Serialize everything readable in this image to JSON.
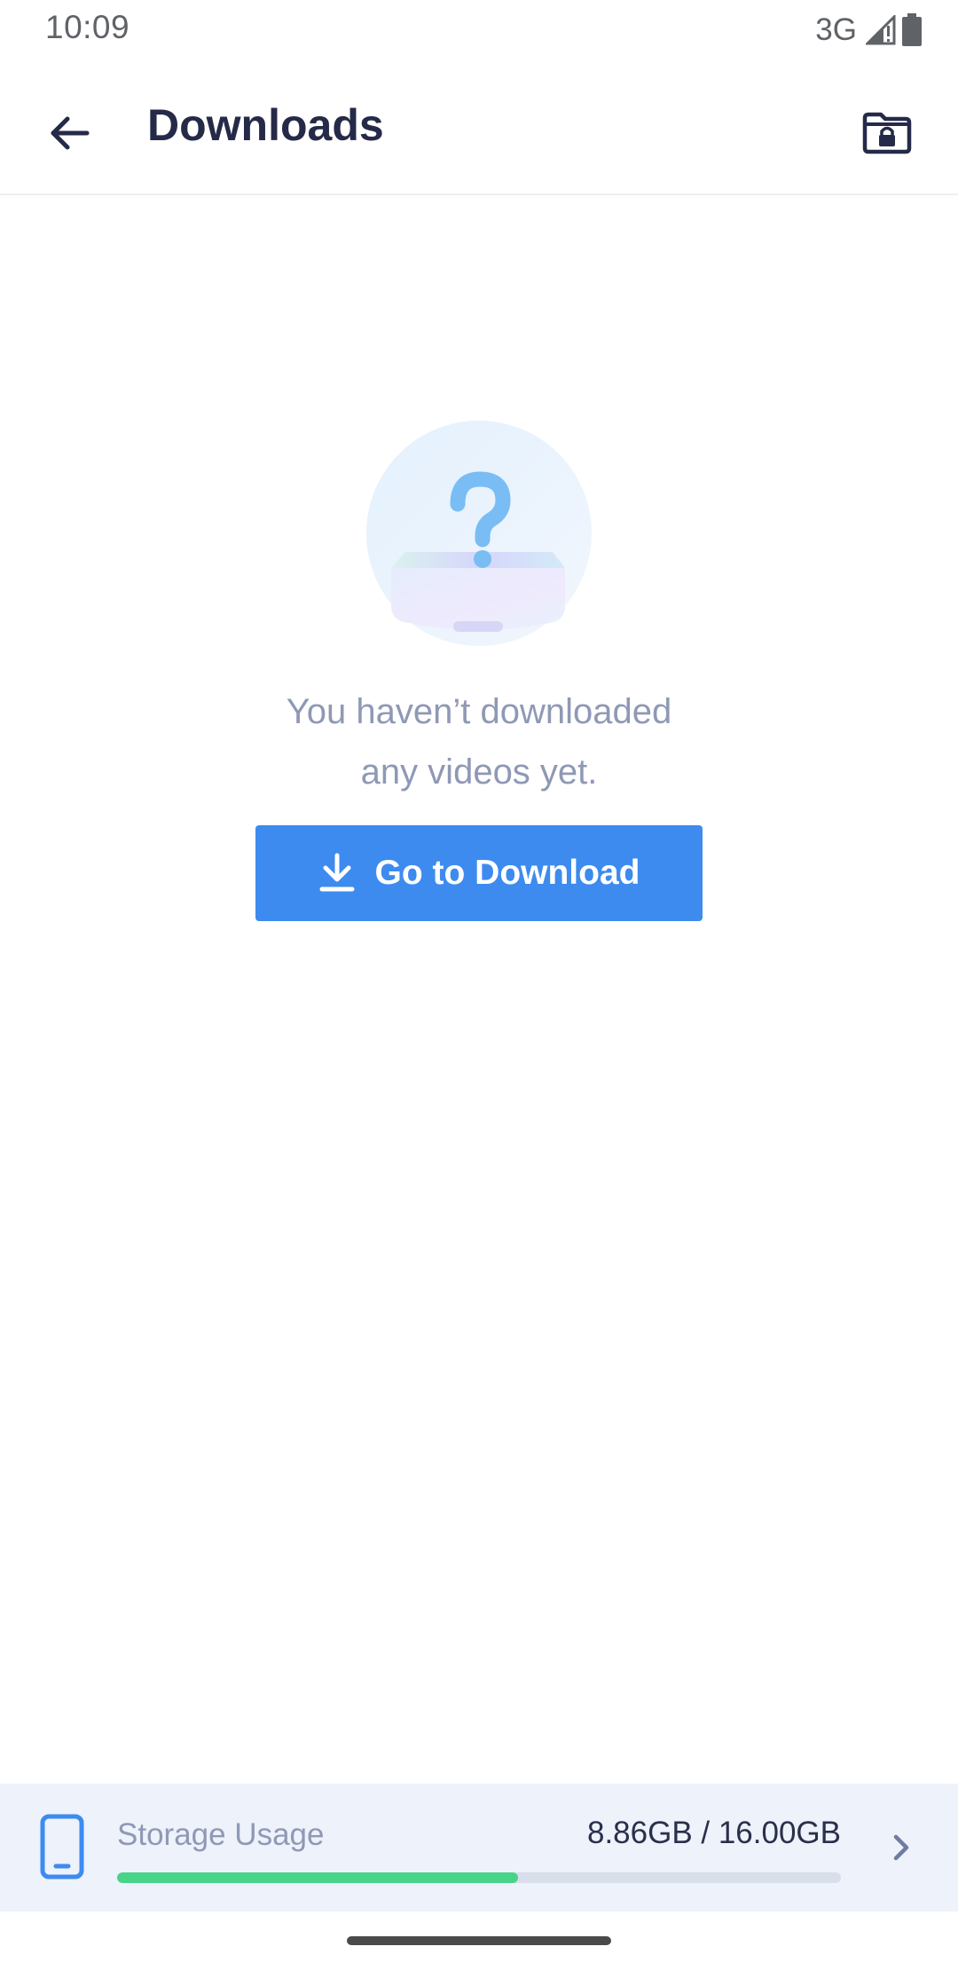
{
  "status_bar": {
    "time": "10:09",
    "network": "3G",
    "icons": [
      "signal-icon",
      "battery-icon"
    ]
  },
  "app_bar": {
    "title": "Downloads",
    "back_icon": "back-arrow-icon",
    "action_icon": "locked-folder-icon"
  },
  "empty_state": {
    "illustration": "empty-box-question-icon",
    "message_line1": "You haven’t downloaded",
    "message_line2": "any videos yet.",
    "button_label": "Go to Download",
    "button_icon": "download-icon"
  },
  "storage": {
    "label": "Storage Usage",
    "value": "8.86GB / 16.00GB",
    "used_fraction": 0.554,
    "icon": "phone-icon",
    "chevron": "chevron-right-icon"
  },
  "colors": {
    "primary": "#3d8bef",
    "title_text": "#252a48",
    "muted_text": "#8f99b5",
    "storage_fill": "#48d488",
    "storage_bg": "#edf2fb"
  }
}
